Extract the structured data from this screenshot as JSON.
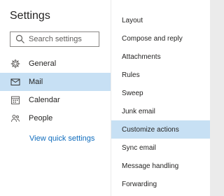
{
  "settings": {
    "title": "Settings",
    "search_placeholder": "Search settings"
  },
  "nav": {
    "items": [
      {
        "label": "General",
        "icon": "gear-icon"
      },
      {
        "label": "Mail",
        "icon": "mail-icon",
        "selected": true
      },
      {
        "label": "Calendar",
        "icon": "calendar-icon"
      },
      {
        "label": "People",
        "icon": "people-icon"
      }
    ],
    "quick_settings_link": "View quick settings"
  },
  "mail_options": {
    "items": [
      "Layout",
      "Compose and reply",
      "Attachments",
      "Rules",
      "Sweep",
      "Junk email",
      "Customize actions",
      "Sync email",
      "Message handling",
      "Forwarding"
    ],
    "selected": "Customize actions"
  },
  "colors": {
    "selected_bg": "#c7e0f4",
    "link": "#0f6cbd",
    "divider": "#ebebeb"
  }
}
